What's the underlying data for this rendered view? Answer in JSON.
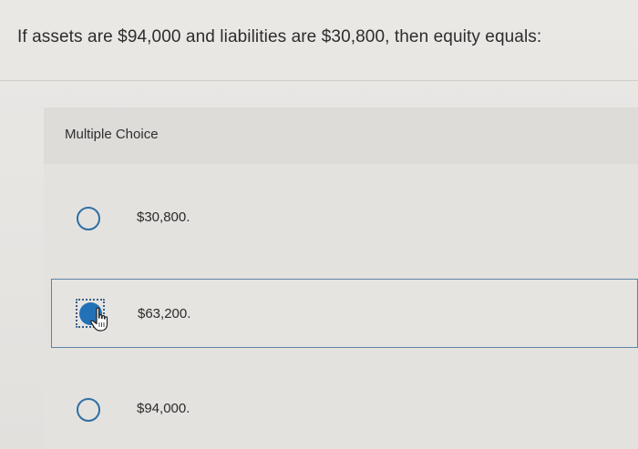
{
  "question": {
    "text": "If assets are $94,000 and liabilities are $30,800, then equity equals:"
  },
  "section": {
    "label": "Multiple Choice"
  },
  "options": [
    {
      "label": "$30,800.",
      "selected": false
    },
    {
      "label": "$63,200.",
      "selected": true
    },
    {
      "label": "$94,000.",
      "selected": false
    }
  ],
  "colors": {
    "radio": "#2f6fa3",
    "selected_fill": "#2372b8",
    "selected_border": "#5f84a6"
  },
  "icons": {
    "cursor": "hand-pointer-icon"
  }
}
